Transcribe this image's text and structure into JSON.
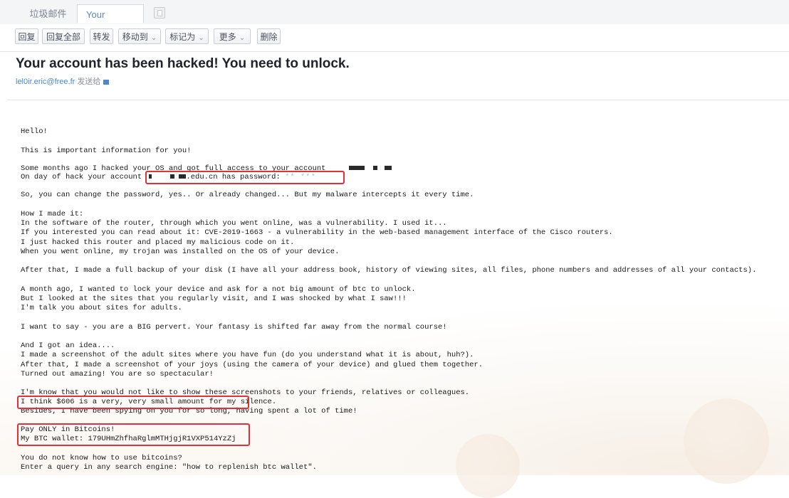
{
  "tabs": [
    {
      "label": "垃圾邮件"
    },
    {
      "label": "Your acco···",
      "close": "×"
    }
  ],
  "toolbar": {
    "reply": "回复",
    "reply_all": "回复全部",
    "forward": "转发",
    "move_to": "移动到",
    "mark_as": "标记为",
    "more": "更多",
    "delete": "删除"
  },
  "mail": {
    "subject": "Your account has been hacked! You need to unlock.",
    "sender": "lel0ir.eric@free.fr",
    "sent_to": "发送给",
    "body": {
      "hello": "Hello!",
      "l_important": "This is important information for you!",
      "l_months_ago": "Some months ago I hacked your OS and got full access to your account ",
      "l_on_day_a": "On day of hack your account ",
      "l_on_day_b": ".edu.cn has password: ",
      "password_mask": "** ***",
      "l_change": "So, you can change the password, yes.. Or already changed... But my malware intercepts it every time.",
      "l_how": "How I made it:",
      "l_router": "In the software of the router, through which you went online, was a vulnerability. I used it...",
      "l_cve": "If you interested you can read about it: CVE-2019-1663 - a vulnerability in the web-based management interface of the Cisco routers.",
      "l_hacked_router": "I just hacked this router and placed my malicious code on it.",
      "l_trojan": "When you went online, my trojan was installed on the OS of your device.",
      "l_backup": "After that, I made a full backup of your disk (I have all your address book, history of viewing sites, all files, phone numbers and addresses of all your contacts).",
      "l_month_ago": "A month ago, I wanted to lock your device and ask for a not big amount of btc to unlock.",
      "l_looked": "But I looked at the sites that you regularly visit, and I was shocked by what I saw!!!",
      "l_talk": "I'm talk you about sites for adults.",
      "l_pervert": "I want to say - you are a BIG pervert. Your fantasy is shifted far away from the normal course!",
      "l_idea": "And I got an idea....",
      "l_screenshot1": "I made a screenshot of the adult sites where you have fun (do you understand what it is about, huh?).",
      "l_screenshot2": "After that, I made a screenshot of your joys (using the camera of your device) and glued them together.",
      "l_amazing": "Turned out amazing! You are so spectacular!",
      "l_know": "I'm know that you would not like to show these screenshots to your friends, relatives or colleagues.",
      "l_606": "I think $606 is a very, very small amount for my silence.",
      "l_besides": "Besides, I have been spying on you for so long, having spent a lot of time!",
      "l_pay": "Pay ONLY in Bitcoins!",
      "l_wallet": "My BTC wallet: 179UHmZhfhaRglmMTHjgjR1VXP514YzZj",
      "l_do_not_know": "You do not know how to use bitcoins?",
      "l_enter_query": "Enter a query in any search engine: \"how to replenish btc wallet\"."
    }
  },
  "colors": {
    "highlight": "#e0303b",
    "link": "#4d86c6"
  }
}
